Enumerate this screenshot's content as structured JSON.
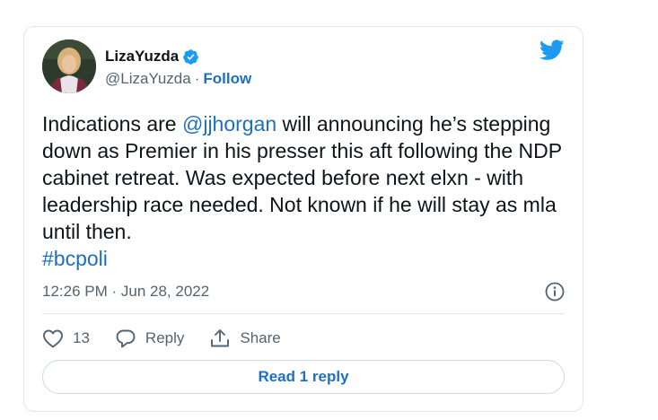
{
  "author": {
    "display_name": "LizaYuzda",
    "handle": "@LizaYuzda",
    "separator": "·",
    "follow_label": "Follow",
    "verified": true
  },
  "tweet": {
    "text_part1": "Indications are ",
    "mention": "@jjhorgan",
    "text_part2": " will announcing he’s stepping down as Premier in his presser this aft following the NDP cabinet retreat. Was expected before next elxn - with leadership race needed. Not known if he will stay as mla until then.",
    "hashtag": "#bcpoli",
    "timestamp": "12:26 PM · Jun 28, 2022"
  },
  "actions": {
    "like_count": "13",
    "reply_label": "Reply",
    "share_label": "Share",
    "read_reply_label": "Read 1 reply"
  },
  "colors": {
    "link": "#1d6fc4",
    "twitter_blue": "#1d9bf0",
    "secondary_text": "#536471",
    "border": "#e2e6ea"
  },
  "icons": [
    "verified-badge-icon",
    "twitter-bird-icon",
    "info-icon",
    "heart-icon",
    "reply-bubble-icon",
    "share-icon"
  ]
}
